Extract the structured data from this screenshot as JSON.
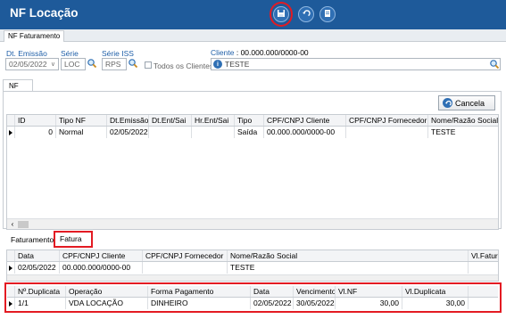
{
  "window": {
    "title": "NF Locação"
  },
  "toolbar": {
    "save_icon": "save-icon",
    "undo_icon": "undo-icon",
    "document_icon": "document-icon"
  },
  "tabs": {
    "faturamento": "NF Faturamento"
  },
  "filters": {
    "dt_emissao_label": "Dt. Emissão",
    "dt_emissao_value": "02/05/2022",
    "serie_label": "Série",
    "serie_value": "LOC",
    "serie_iss_label": "Série ISS",
    "serie_iss_value": "RPS",
    "todos_clientes_label": "Todos os Clientes",
    "cliente_label": "Cliente",
    "cliente_code": ": 00.000.000/0000-00",
    "cliente_name": "TESTE"
  },
  "nf_tab": {
    "label": "NF"
  },
  "cancel_button": {
    "label": "Cancela"
  },
  "nf_grid": {
    "headers": [
      "ID",
      "Tipo NF",
      "Dt.Emissão",
      "Dt.Ent/Sai",
      "Hr.Ent/Sai",
      "Tipo",
      "CPF/CNPJ Cliente",
      "CPF/CNPJ Fornecedor",
      "Nome/Razão Social"
    ],
    "row": [
      "0",
      "Normal",
      "02/05/2022",
      "",
      "",
      "Saída",
      "00.000.000/0000-00",
      "",
      "TESTE"
    ]
  },
  "bottom_tabs": {
    "faturamento": "Faturamento",
    "fatura": "Fatura"
  },
  "fatura_grid": {
    "headers": [
      "Data",
      "CPF/CNPJ Cliente",
      "CPF/CNPJ  Fornecedor",
      "Nome/Razão Social",
      "Vl.Fatura"
    ],
    "row": [
      "02/05/2022",
      "00.000.000/0000-00",
      "",
      "TESTE",
      ""
    ]
  },
  "duplicata_grid": {
    "headers": [
      "Nº.Duplicata",
      "Operação",
      "Forma Pagamento",
      "Data",
      "Vencimento",
      "Vl.NF",
      "Vl.Duplicata"
    ],
    "row": [
      "1/1",
      "VDA LOCAÇÃO",
      "DINHEIRO",
      "02/05/2022",
      "30/05/2022",
      "30,00",
      "30,00"
    ]
  },
  "colors": {
    "title_bar": "#1e5a9a",
    "highlight": "#e31b23",
    "label_blue": "#1f5fa8"
  }
}
